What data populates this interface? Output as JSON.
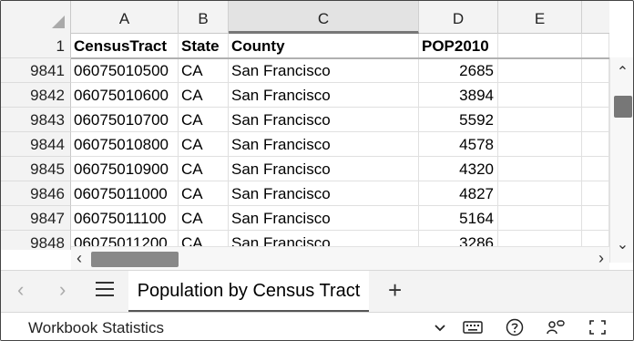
{
  "grid": {
    "corner_row_number": "1",
    "columns": [
      "A",
      "B",
      "C",
      "D",
      "E"
    ],
    "header_row": {
      "row_number": "1",
      "cells": [
        "CensusTract",
        "State",
        "County",
        "POP2010",
        ""
      ]
    },
    "rows": [
      {
        "row_number": "9841",
        "cells": [
          "06075010500",
          "CA",
          "San Francisco",
          "2685",
          ""
        ]
      },
      {
        "row_number": "9842",
        "cells": [
          "06075010600",
          "CA",
          "San Francisco",
          "3894",
          ""
        ]
      },
      {
        "row_number": "9843",
        "cells": [
          "06075010700",
          "CA",
          "San Francisco",
          "5592",
          ""
        ]
      },
      {
        "row_number": "9844",
        "cells": [
          "06075010800",
          "CA",
          "San Francisco",
          "4578",
          ""
        ]
      },
      {
        "row_number": "9845",
        "cells": [
          "06075010900",
          "CA",
          "San Francisco",
          "4320",
          ""
        ]
      },
      {
        "row_number": "9846",
        "cells": [
          "06075011000",
          "CA",
          "San Francisco",
          "4827",
          ""
        ]
      },
      {
        "row_number": "9847",
        "cells": [
          "06075011100",
          "CA",
          "San Francisco",
          "5164",
          ""
        ]
      },
      {
        "row_number": "9848",
        "cells": [
          "06075011200",
          "CA",
          "San Francisco",
          "3286",
          ""
        ]
      }
    ],
    "selected_column": "C"
  },
  "tabs": {
    "active_sheet": "Population by Census Tract",
    "add_label": "+"
  },
  "status": {
    "text": "Workbook Statistics"
  },
  "icons": {
    "prev_sheet": "chevron-left-icon",
    "next_sheet": "chevron-right-icon",
    "sheet_list": "hamburger-menu-icon",
    "add_sheet": "plus-icon",
    "collapse": "chevron-down-icon",
    "keyboard": "keyboard-icon",
    "help": "help-icon",
    "accessibility": "accessibility-icon",
    "fullscreen": "fullscreen-icon"
  },
  "colors": {
    "header_bg": "#f3f3f3",
    "gridline": "#e0e0e0",
    "scroll_thumb": "#777777"
  }
}
